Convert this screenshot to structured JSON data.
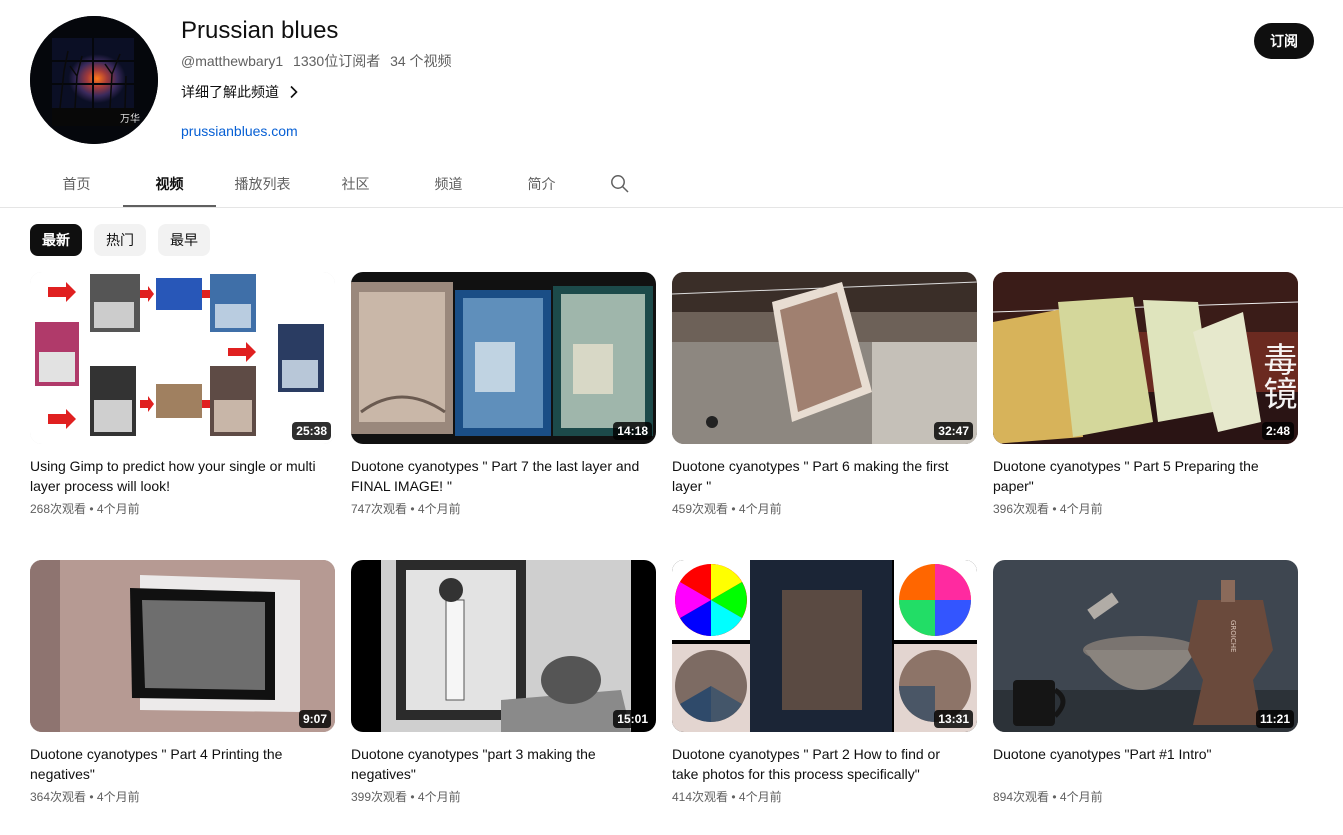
{
  "channel": {
    "name": "Prussian blues",
    "handle": "@matthewbary1",
    "subscribers": "1330位订阅者",
    "video_count": "34 个视频",
    "about_label": "详细了解此频道",
    "website": "prussianblues.com",
    "subscribe_label": "订阅"
  },
  "tabs": [
    "首页",
    "视频",
    "播放列表",
    "社区",
    "频道",
    "简介"
  ],
  "chips": [
    "最新",
    "热门",
    "最早"
  ],
  "videos": [
    {
      "title": "Using Gimp to predict how your single or multi layer process will look!",
      "duration": "25:38",
      "views": "268次观看",
      "age": "4个月前"
    },
    {
      "title": "Duotone cyanotypes \" Part 7 the last layer and FINAL IMAGE! \"",
      "duration": "14:18",
      "views": "747次观看",
      "age": "4个月前"
    },
    {
      "title": "Duotone cyanotypes \" Part 6 making the first layer \"",
      "duration": "32:47",
      "views": "459次观看",
      "age": "4个月前"
    },
    {
      "title": "Duotone cyanotypes \" Part 5 Preparing the paper\"",
      "duration": "2:48",
      "views": "396次观看",
      "age": "4个月前",
      "overlay_text": "毒镜"
    },
    {
      "title": "Duotone cyanotypes \" Part 4 Printing the negatives\"",
      "duration": "9:07",
      "views": "364次观看",
      "age": "4个月前"
    },
    {
      "title": "Duotone cyanotypes \"part 3 making the negatives\"",
      "duration": "15:01",
      "views": "399次观看",
      "age": "4个月前"
    },
    {
      "title": "Duotone cyanotypes \" Part 2 How to find or take photos for this process specifically\"",
      "duration": "13:31",
      "views": "414次观看",
      "age": "4个月前"
    },
    {
      "title": "Duotone cyanotypes \"Part #1 Intro\"",
      "duration": "11:21",
      "views": "894次观看",
      "age": "4个月前"
    }
  ],
  "meta_separator": " • ",
  "icons": {
    "search": "search-icon",
    "chevron": "chevron-right-icon"
  }
}
